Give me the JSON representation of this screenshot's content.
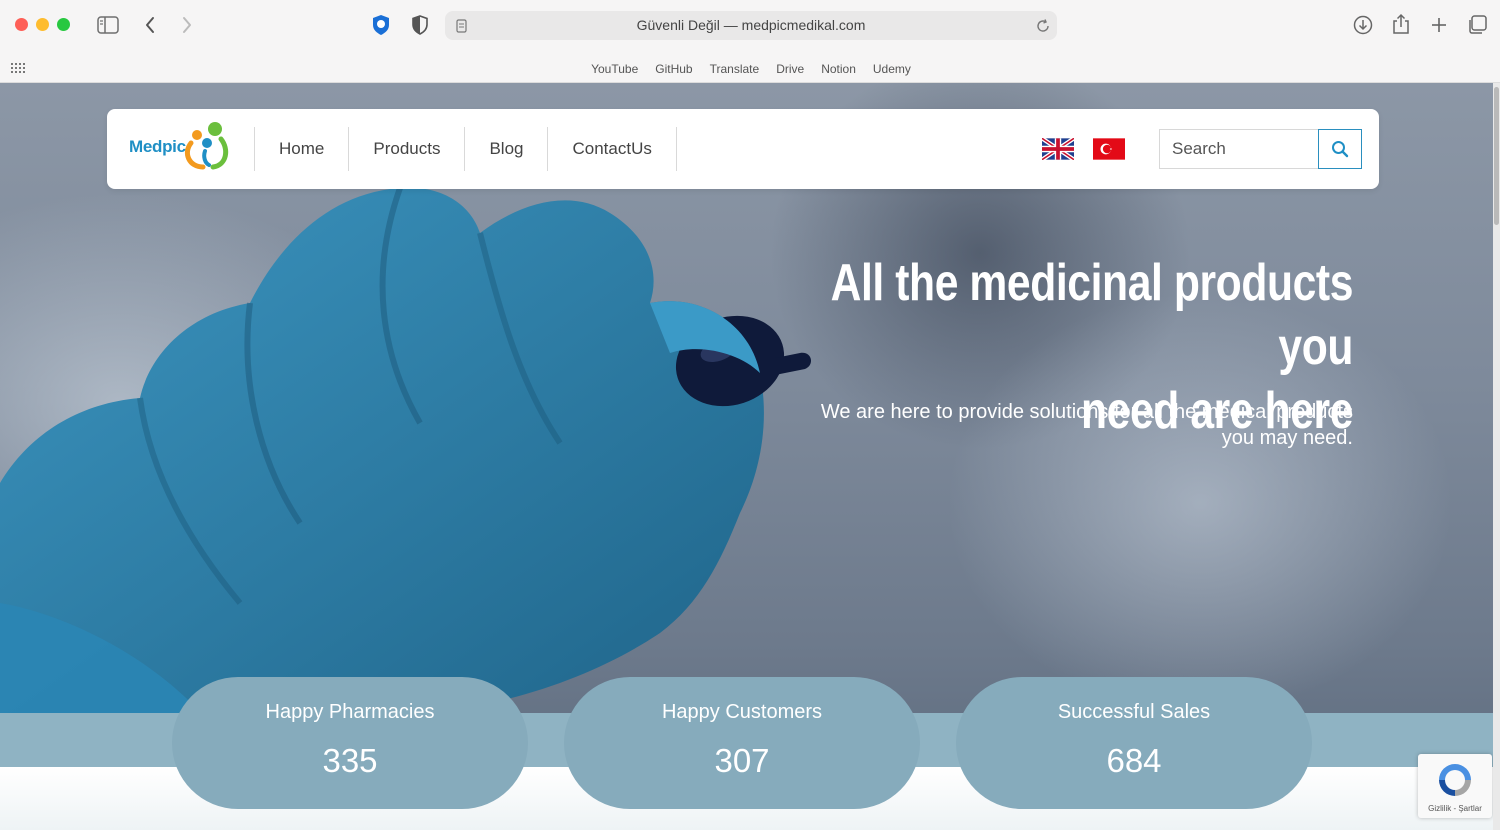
{
  "browser": {
    "address": "Güvenli Değil — medpicmedikal.com",
    "favorites": [
      "YouTube",
      "GitHub",
      "Translate",
      "Drive",
      "Notion",
      "Udemy"
    ]
  },
  "nav": {
    "logo_text": "Medpic",
    "links": [
      "Home",
      "Products",
      "Blog",
      "ContactUs"
    ],
    "search_placeholder": "Search"
  },
  "hero": {
    "title_line1": "All the medicinal products you",
    "title_line2": "need are here",
    "subtitle_line1": "We are here to provide solutions for all the medical products",
    "subtitle_line2": "you may need."
  },
  "stats": [
    {
      "label": "Happy Pharmacies",
      "value": "335"
    },
    {
      "label": "Happy Customers",
      "value": "307"
    },
    {
      "label": "Successful Sales",
      "value": "684"
    }
  ],
  "recaptcha": {
    "text": "Gizlilik - Şartlar"
  },
  "colors": {
    "accent": "#1f8fc5",
    "stat_card": "#86abbc",
    "stat_band": "#8fb3c3",
    "glove": "#2f7fa8"
  }
}
